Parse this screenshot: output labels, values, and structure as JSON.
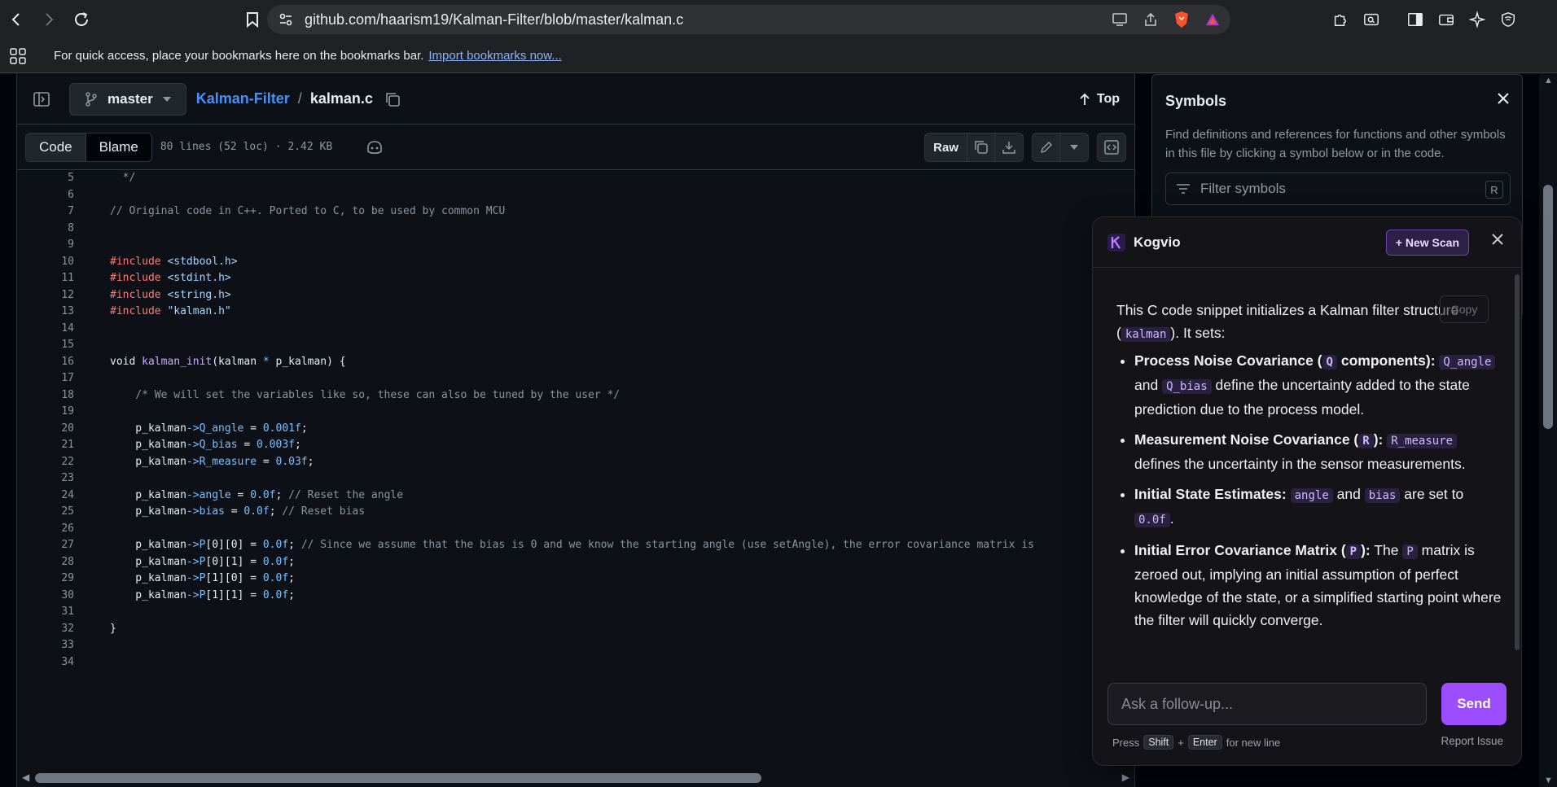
{
  "browser": {
    "url": "github.com/haarism19/Kalman-Filter/blob/master/kalman.c",
    "bookmarks_message": "For quick access, place your bookmarks here on the bookmarks bar.",
    "bookmarks_link": "Import bookmarks now..."
  },
  "file_header": {
    "branch": "master",
    "repo": "Kalman-Filter",
    "separator": "/",
    "file": "kalman.c",
    "top_label": "Top"
  },
  "toolbar": {
    "code_tab": "Code",
    "blame_tab": "Blame",
    "meta": "80 lines (52 loc) · 2.42 KB",
    "raw_label": "Raw"
  },
  "code_lines": [
    {
      "n": "5",
      "t": "  */"
    },
    {
      "n": "6",
      "t": ""
    },
    {
      "n": "7",
      "t": "// Original code in C++. Ported to C, to be used by common MCU"
    },
    {
      "n": "8",
      "t": ""
    },
    {
      "n": "9",
      "t": ""
    },
    {
      "n": "10",
      "t": "#include <stdbool.h>"
    },
    {
      "n": "11",
      "t": "#include <stdint.h>"
    },
    {
      "n": "12",
      "t": "#include <string.h>"
    },
    {
      "n": "13",
      "t": "#include \"kalman.h\""
    },
    {
      "n": "14",
      "t": ""
    },
    {
      "n": "15",
      "t": ""
    },
    {
      "n": "16",
      "t": "void kalman_init(kalman * p_kalman) {"
    },
    {
      "n": "17",
      "t": ""
    },
    {
      "n": "18",
      "t": "    /* We will set the variables like so, these can also be tuned by the user */"
    },
    {
      "n": "19",
      "t": ""
    },
    {
      "n": "20",
      "t": "    p_kalman->Q_angle = 0.001f;"
    },
    {
      "n": "21",
      "t": "    p_kalman->Q_bias = 0.003f;"
    },
    {
      "n": "22",
      "t": "    p_kalman->R_measure = 0.03f;"
    },
    {
      "n": "23",
      "t": ""
    },
    {
      "n": "24",
      "t": "    p_kalman->angle = 0.0f; // Reset the angle"
    },
    {
      "n": "25",
      "t": "    p_kalman->bias = 0.0f; // Reset bias"
    },
    {
      "n": "26",
      "t": ""
    },
    {
      "n": "27",
      "t": "    p_kalman->P[0][0] = 0.0f; // Since we assume that the bias is 0 and we know the starting angle (use setAngle), the error covariance matrix is"
    },
    {
      "n": "28",
      "t": "    p_kalman->P[0][1] = 0.0f;"
    },
    {
      "n": "29",
      "t": "    p_kalman->P[1][0] = 0.0f;"
    },
    {
      "n": "30",
      "t": "    p_kalman->P[1][1] = 0.0f;"
    },
    {
      "n": "31",
      "t": ""
    },
    {
      "n": "32",
      "t": "}"
    },
    {
      "n": "33",
      "t": ""
    },
    {
      "n": "34",
      "t": ""
    }
  ],
  "symbols": {
    "title": "Symbols",
    "description": "Find definitions and references for functions and other symbols in this file by clicking a symbol below or in the code.",
    "filter_placeholder": "Filter symbols",
    "filter_key": "R"
  },
  "kogvio": {
    "name": "Kogvio",
    "new_scan": "+ New Scan",
    "copy_label": "Copy",
    "intro_a": "This C code snippet initializes a Kalman filter structure (",
    "intro_code": "kalman",
    "intro_b": "). It sets:",
    "items": {
      "q_title_a": "Process Noise Covariance (",
      "q_title_code": "Q",
      "q_title_b": " components):",
      "q_code1": "Q_angle",
      "q_and": " and ",
      "q_code2": "Q_bias",
      "q_text": " define the uncertainty added to the state prediction due to the process model.",
      "r_title_a": "Measurement Noise Covariance (",
      "r_title_code": "R",
      "r_title_b": "):",
      "r_code": "R_measure",
      "r_text": " defines the uncertainty in the sensor measurements.",
      "s_title": "Initial State Estimates:",
      "s_code1": "angle",
      "s_and": " and ",
      "s_code2": "bias",
      "s_mid": " are set to ",
      "s_code3": "0.0f",
      "s_end": ".",
      "p_title_a": "Initial Error Covariance Matrix (",
      "p_title_code": "P",
      "p_title_b": "):",
      "p_pre": " The ",
      "p_code": "P",
      "p_text": " matrix is zeroed out, implying an initial assumption of perfect knowledge of the state, or a simplified starting point where the filter will quickly converge."
    },
    "input_placeholder": "Ask a follow-up...",
    "send_label": "Send",
    "hint_press": "Press",
    "hint_shift": "Shift",
    "hint_plus": "+",
    "hint_enter": "Enter",
    "hint_tail": "for new line",
    "report_issue": "Report Issue"
  },
  "colors": {
    "accent_link": "#4493f8",
    "kogvio_send": "#9b4dff",
    "bg": "#0d1117"
  }
}
